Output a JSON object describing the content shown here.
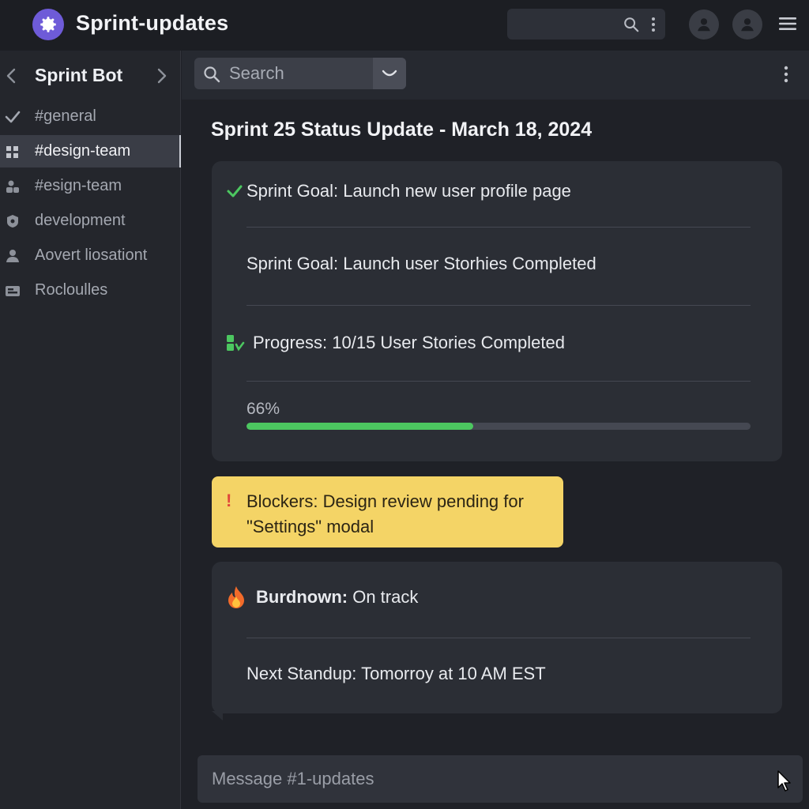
{
  "app": {
    "title": "Sprint-updates",
    "brand_color": "#6e5bd8"
  },
  "sidebar": {
    "title": "Sprint Bot",
    "channels": [
      {
        "label": "#general",
        "icon": "check-icon"
      },
      {
        "label": "#design-team",
        "icon": "grid-icon",
        "active": true
      },
      {
        "label": "#esign-team",
        "icon": "people-icon"
      },
      {
        "label": "development",
        "icon": "shield-icon"
      },
      {
        "label": "Aovert liosationt",
        "icon": "user-icon"
      },
      {
        "label": "Rocloulles",
        "icon": "inbox-icon"
      }
    ]
  },
  "search": {
    "placeholder": "Search"
  },
  "post": {
    "title": "Sprint 25 Status Update - March 18, 2024",
    "goal": "Sprint Goal: Launch new user profile page",
    "goal_repeat": "Sprint Goal: Launch user Storhies Completed",
    "progress": "Progress: 10/15 User Stories Completed",
    "percent_label": "66%",
    "percent_value": 0.45,
    "blocker": "Blockers: Design review pending for \"Settings\" modal",
    "burndown_label": "Burdnown:",
    "burndown_value": " On track",
    "next_standup": "Next Standup: Tomorroy at 10 AM EST",
    "success_color": "#4cc760",
    "warning_color": "#f4d466"
  },
  "composer": {
    "placeholder": "Message #1-updates"
  }
}
